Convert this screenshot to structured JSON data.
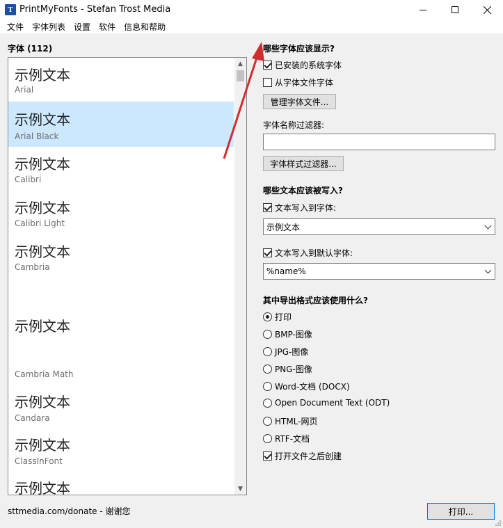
{
  "window": {
    "title": "PrintMyFonts - Stefan Trost Media",
    "app_icon_glyph": "T"
  },
  "menu": [
    "文件",
    "字体列表",
    "设置",
    "软件",
    "信息和帮助"
  ],
  "fontlist": {
    "label": "字体 (112)",
    "sample_text": "示例文本",
    "items": [
      {
        "sample": "示例文本",
        "name": "Arial"
      },
      {
        "sample": "示例文本",
        "name": "Arial Black"
      },
      {
        "sample": "示例文本",
        "name": "Calibri"
      },
      {
        "sample": "示例文本",
        "name": "Calibri Light"
      },
      {
        "sample": "示例文本",
        "name": "Cambria"
      },
      {
        "sample": "示例文本",
        "name": "Cambria Math"
      },
      {
        "sample": "示例文本",
        "name": "Candara"
      },
      {
        "sample": "示例文本",
        "name": "ClassInFont"
      },
      {
        "sample": "示例文本",
        "name": ""
      }
    ],
    "selected_index": 1
  },
  "options": {
    "which_fonts_title": "哪些字体应该显示?",
    "installed_fonts": "已安装的系统字体",
    "installed_checked": true,
    "from_files": "从字体文件字体",
    "from_files_checked": false,
    "manage_files_button": "管理字体文件...",
    "name_filter_label": "字体名称过滤器:",
    "name_filter_value": "",
    "style_filter_button": "字体样式过滤器...",
    "which_text_title": "哪些文本应该被写入?",
    "write_to_font": "文本写入到字体:",
    "write_to_font_checked": true,
    "write_to_font_value": "示例文本",
    "write_default": "文本写入到默认字体:",
    "write_default_checked": true,
    "write_default_value": "%name%",
    "export_title": "其中导出格式应该使用什么?",
    "formats": [
      "打印",
      "BMP-图像",
      "JPG-图像",
      "PNG-图像",
      "Word-文档 (DOCX)",
      "Open Document Text (ODT)",
      "HTML-网页",
      "RTF-文档"
    ],
    "selected_format_index": 0,
    "open_after": "打开文件之后创建",
    "open_after_checked": true
  },
  "status_text": "sttmedia.com/donate - 谢谢您",
  "print_button": "打印...",
  "colors": {
    "selection": "#cce8ff",
    "annotation_arrow": "#d12d2d",
    "accent_border": "#0078d7"
  }
}
